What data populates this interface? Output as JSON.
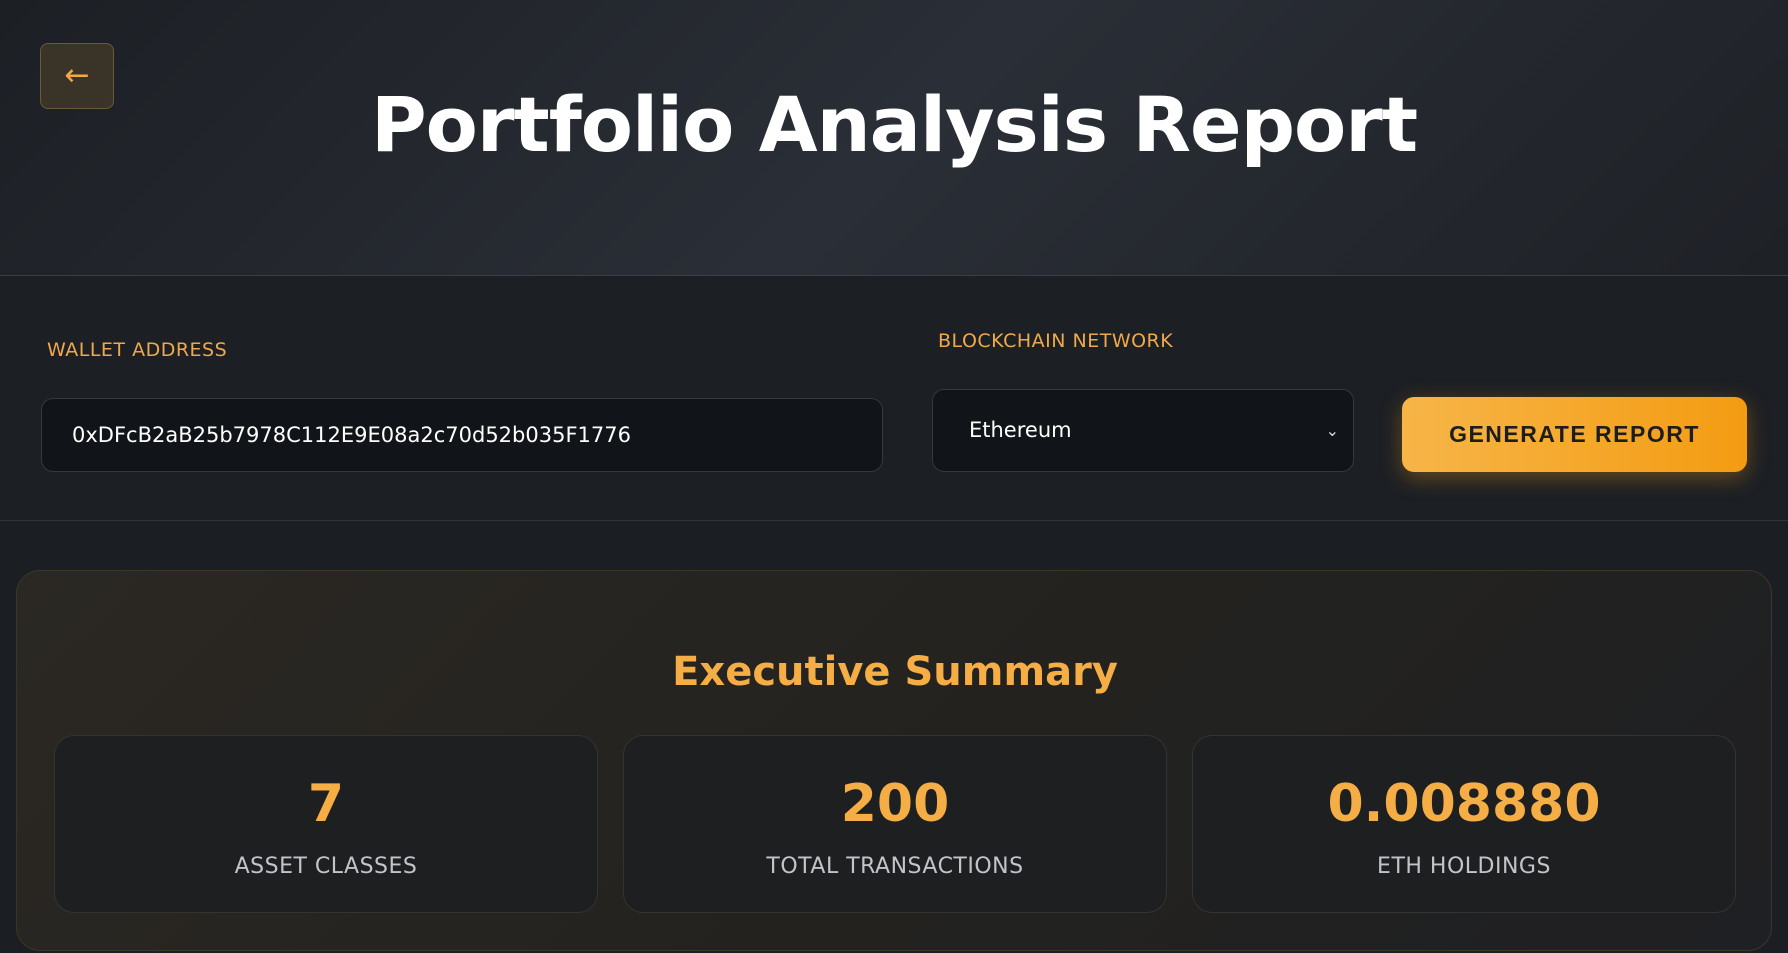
{
  "header": {
    "back_icon": "←",
    "title": "Portfolio Analysis Report"
  },
  "form": {
    "wallet_label": "WALLET ADDRESS",
    "wallet_value": "0xDFcB2aB25b7978C112E9E08a2c70d52b035F1776",
    "network_label": "BLOCKCHAIN NETWORK",
    "network_selected": "Ethereum",
    "chevron_icon": "⌄",
    "generate_label": "GENERATE REPORT"
  },
  "summary": {
    "title": "Executive Summary",
    "stats": [
      {
        "value": "7",
        "label": "ASSET CLASSES"
      },
      {
        "value": "200",
        "label": "TOTAL TRANSACTIONS"
      },
      {
        "value": "0.008880",
        "label": "ETH HOLDINGS"
      }
    ]
  },
  "colors": {
    "accent": "#f5ad45",
    "button_gradient_start": "#f7b548",
    "button_gradient_end": "#f39c12",
    "background": "#1b1e23"
  }
}
